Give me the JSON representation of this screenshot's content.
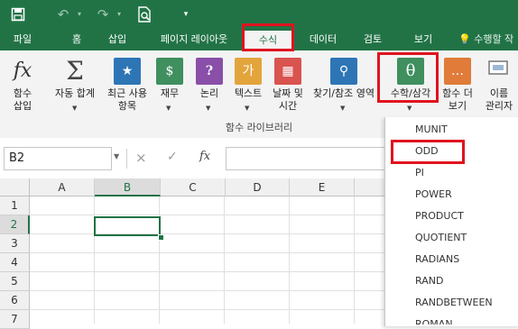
{
  "quick_access": {
    "save_icon": "save-icon",
    "undo_icon": "undo-icon",
    "redo_icon": "redo-icon",
    "preview_icon": "print-preview-icon",
    "customize_icon": "customize-qat-icon"
  },
  "tabs": [
    {
      "label": "파일"
    },
    {
      "label": "홈"
    },
    {
      "label": "삽입"
    },
    {
      "label": "페이지 레이아웃"
    },
    {
      "label": "수식",
      "active": true
    },
    {
      "label": "데이터"
    },
    {
      "label": "검토"
    },
    {
      "label": "보기"
    }
  ],
  "tell_me": {
    "icon": "lightbulb-icon",
    "text": "수행할 작"
  },
  "ribbon": {
    "buttons": [
      {
        "line1": "함수",
        "line2": "삽입",
        "icon": "fx-icon",
        "glyph": "fx"
      },
      {
        "line1": "자동 합계",
        "line2": "",
        "icon": "sigma-icon",
        "glyph": "Σ"
      },
      {
        "line1": "최근 사용",
        "line2": "항목",
        "icon": "star-book-icon",
        "glyph": "★"
      },
      {
        "line1": "재무",
        "line2": "",
        "icon": "finance-book-icon",
        "glyph": "$"
      },
      {
        "line1": "논리",
        "line2": "",
        "icon": "logic-book-icon",
        "glyph": "?"
      },
      {
        "line1": "텍스트",
        "line2": "",
        "icon": "text-book-icon",
        "glyph": "가"
      },
      {
        "line1": "날짜 및",
        "line2": "시간",
        "icon": "datetime-book-icon",
        "glyph": "▦"
      },
      {
        "line1": "찾기/참조 영역",
        "line2": "",
        "icon": "lookup-book-icon",
        "glyph": "⚲"
      },
      {
        "line1": "수학/삼각",
        "line2": "",
        "icon": "math-trig-book-icon",
        "glyph": "θ"
      },
      {
        "line1": "함수 더",
        "line2": "보기",
        "icon": "more-functions-icon",
        "glyph": "…"
      },
      {
        "line1": "이름",
        "line2": "관리자",
        "icon": "name-manager-icon",
        "glyph": ""
      }
    ],
    "group_label": "함수 라이브러리"
  },
  "formula_bar": {
    "name_box": "B2",
    "cancel_icon": "×",
    "enter_icon": "✓",
    "fx_label": "fx",
    "formula": ""
  },
  "grid": {
    "columns": [
      "A",
      "B",
      "C",
      "D",
      "E"
    ],
    "rows": [
      "1",
      "2",
      "3",
      "4",
      "5",
      "6",
      "7"
    ],
    "selected_cell": "B2"
  },
  "dropdown": {
    "items": [
      "MUNIT",
      "ODD",
      "PI",
      "POWER",
      "PRODUCT",
      "QUOTIENT",
      "RADIANS",
      "RAND",
      "RANDBETWEEN",
      "ROMAN"
    ],
    "highlighted": "ODD"
  },
  "colors": {
    "brand": "#217346",
    "highlight": "#e0131f",
    "ribbon_bg": "#f3f3f3"
  }
}
